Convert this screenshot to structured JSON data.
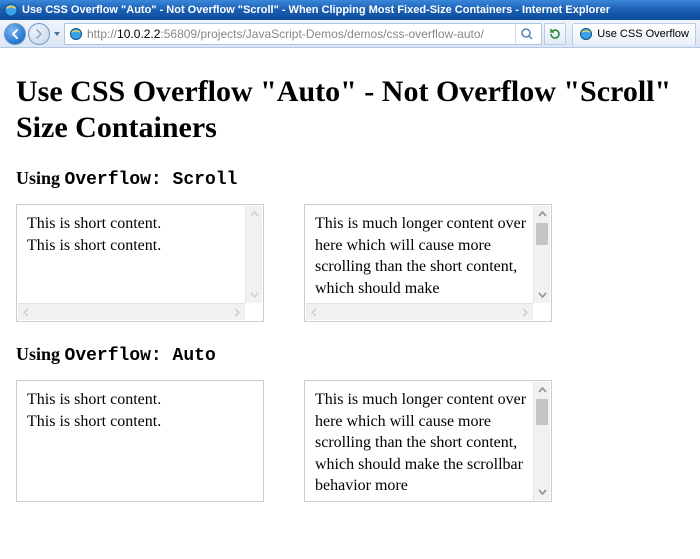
{
  "window": {
    "title": "Use CSS Overflow \"Auto\" - Not Overflow \"Scroll\" - When Clipping Most Fixed-Size Containers - Internet Explorer"
  },
  "address": {
    "scheme": "http://",
    "host": "10.0.2.2",
    "path": ":56809/projects/JavaScript-Demos/demos/css-overflow-auto/"
  },
  "tab": {
    "label": "Use CSS Overflow"
  },
  "page": {
    "h1_line1": "Use CSS Overflow \"Auto\" - Not Overflow \"Scroll\"",
    "h1_line2": "Size Containers",
    "section1": {
      "prefix": "Using ",
      "code": "Overflow: Scroll",
      "box_a": "This is short content.\nThis is short content.",
      "box_b": "This is much longer content over here which will cause more scrolling than the short content, which should make"
    },
    "section2": {
      "prefix": "Using ",
      "code": "Overflow: Auto",
      "box_a": "This is short content.\nThis is short content.",
      "box_b": "This is much longer content over here which will cause more scrolling than the short content, which should make the scrollbar behavior more"
    }
  }
}
